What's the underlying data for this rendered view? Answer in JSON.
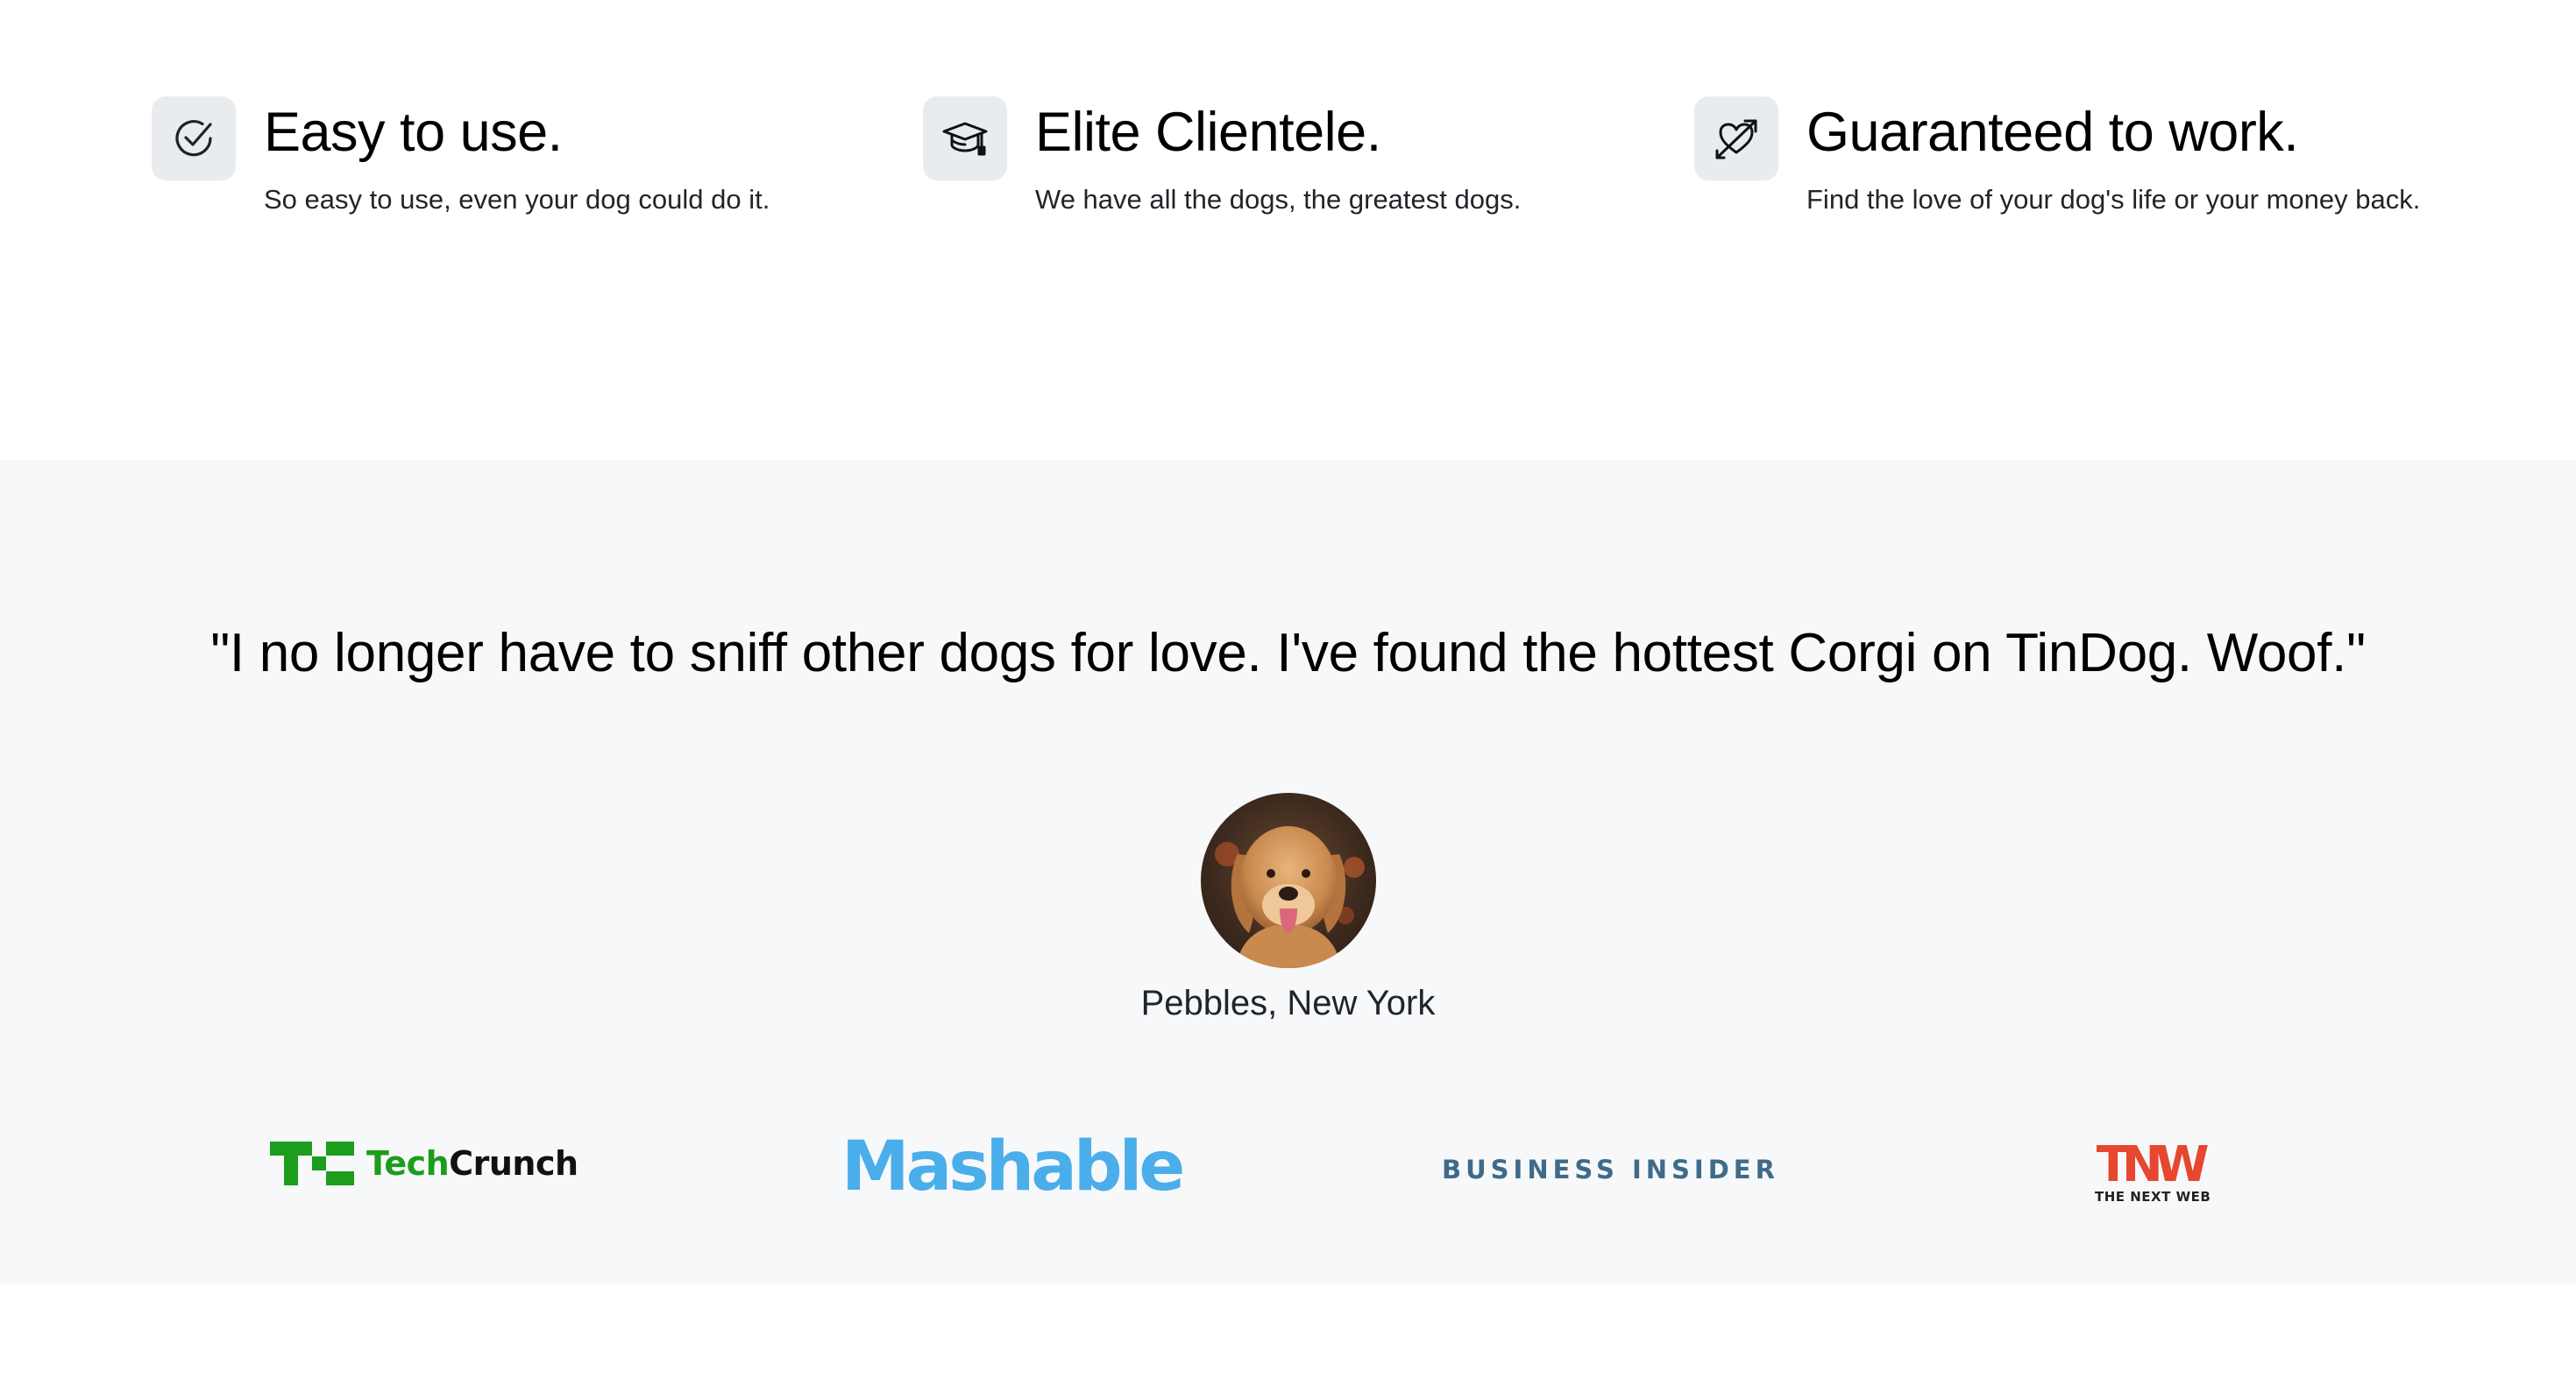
{
  "features": [
    {
      "icon": "check-circle-icon",
      "title": "Easy to use.",
      "description": "So easy to use, even your dog could do it."
    },
    {
      "icon": "graduation-cap-icon",
      "title": "Elite Clientele.",
      "description": "We have all the dogs, the greatest dogs."
    },
    {
      "icon": "heart-arrow-icon",
      "title": "Guaranteed to work.",
      "description": "Find the love of your dog's life or your money back."
    }
  ],
  "testimonial": {
    "quote": "\"I no longer have to sniff other dogs for love. I've found the hottest Corgi on TinDog. Woof.\"",
    "author": "Pebbles, New York",
    "avatar_icon": "dog-avatar"
  },
  "press": {
    "techcrunch": {
      "tech": "Tech",
      "crunch": "Crunch"
    },
    "mashable": "Mashable",
    "business_insider": "BUSINESS INSIDER",
    "tnw": {
      "mark": "TNW",
      "tagline": "THE NEXT WEB"
    }
  },
  "colors": {
    "icon_bg": "#e9ecef",
    "testimonial_bg": "#f7f8fa",
    "techcrunch_green": "#1c9d1c",
    "mashable_blue": "#4aaeea",
    "business_insider_blue": "#3f6b8a",
    "tnw_red": "#e6472e"
  }
}
